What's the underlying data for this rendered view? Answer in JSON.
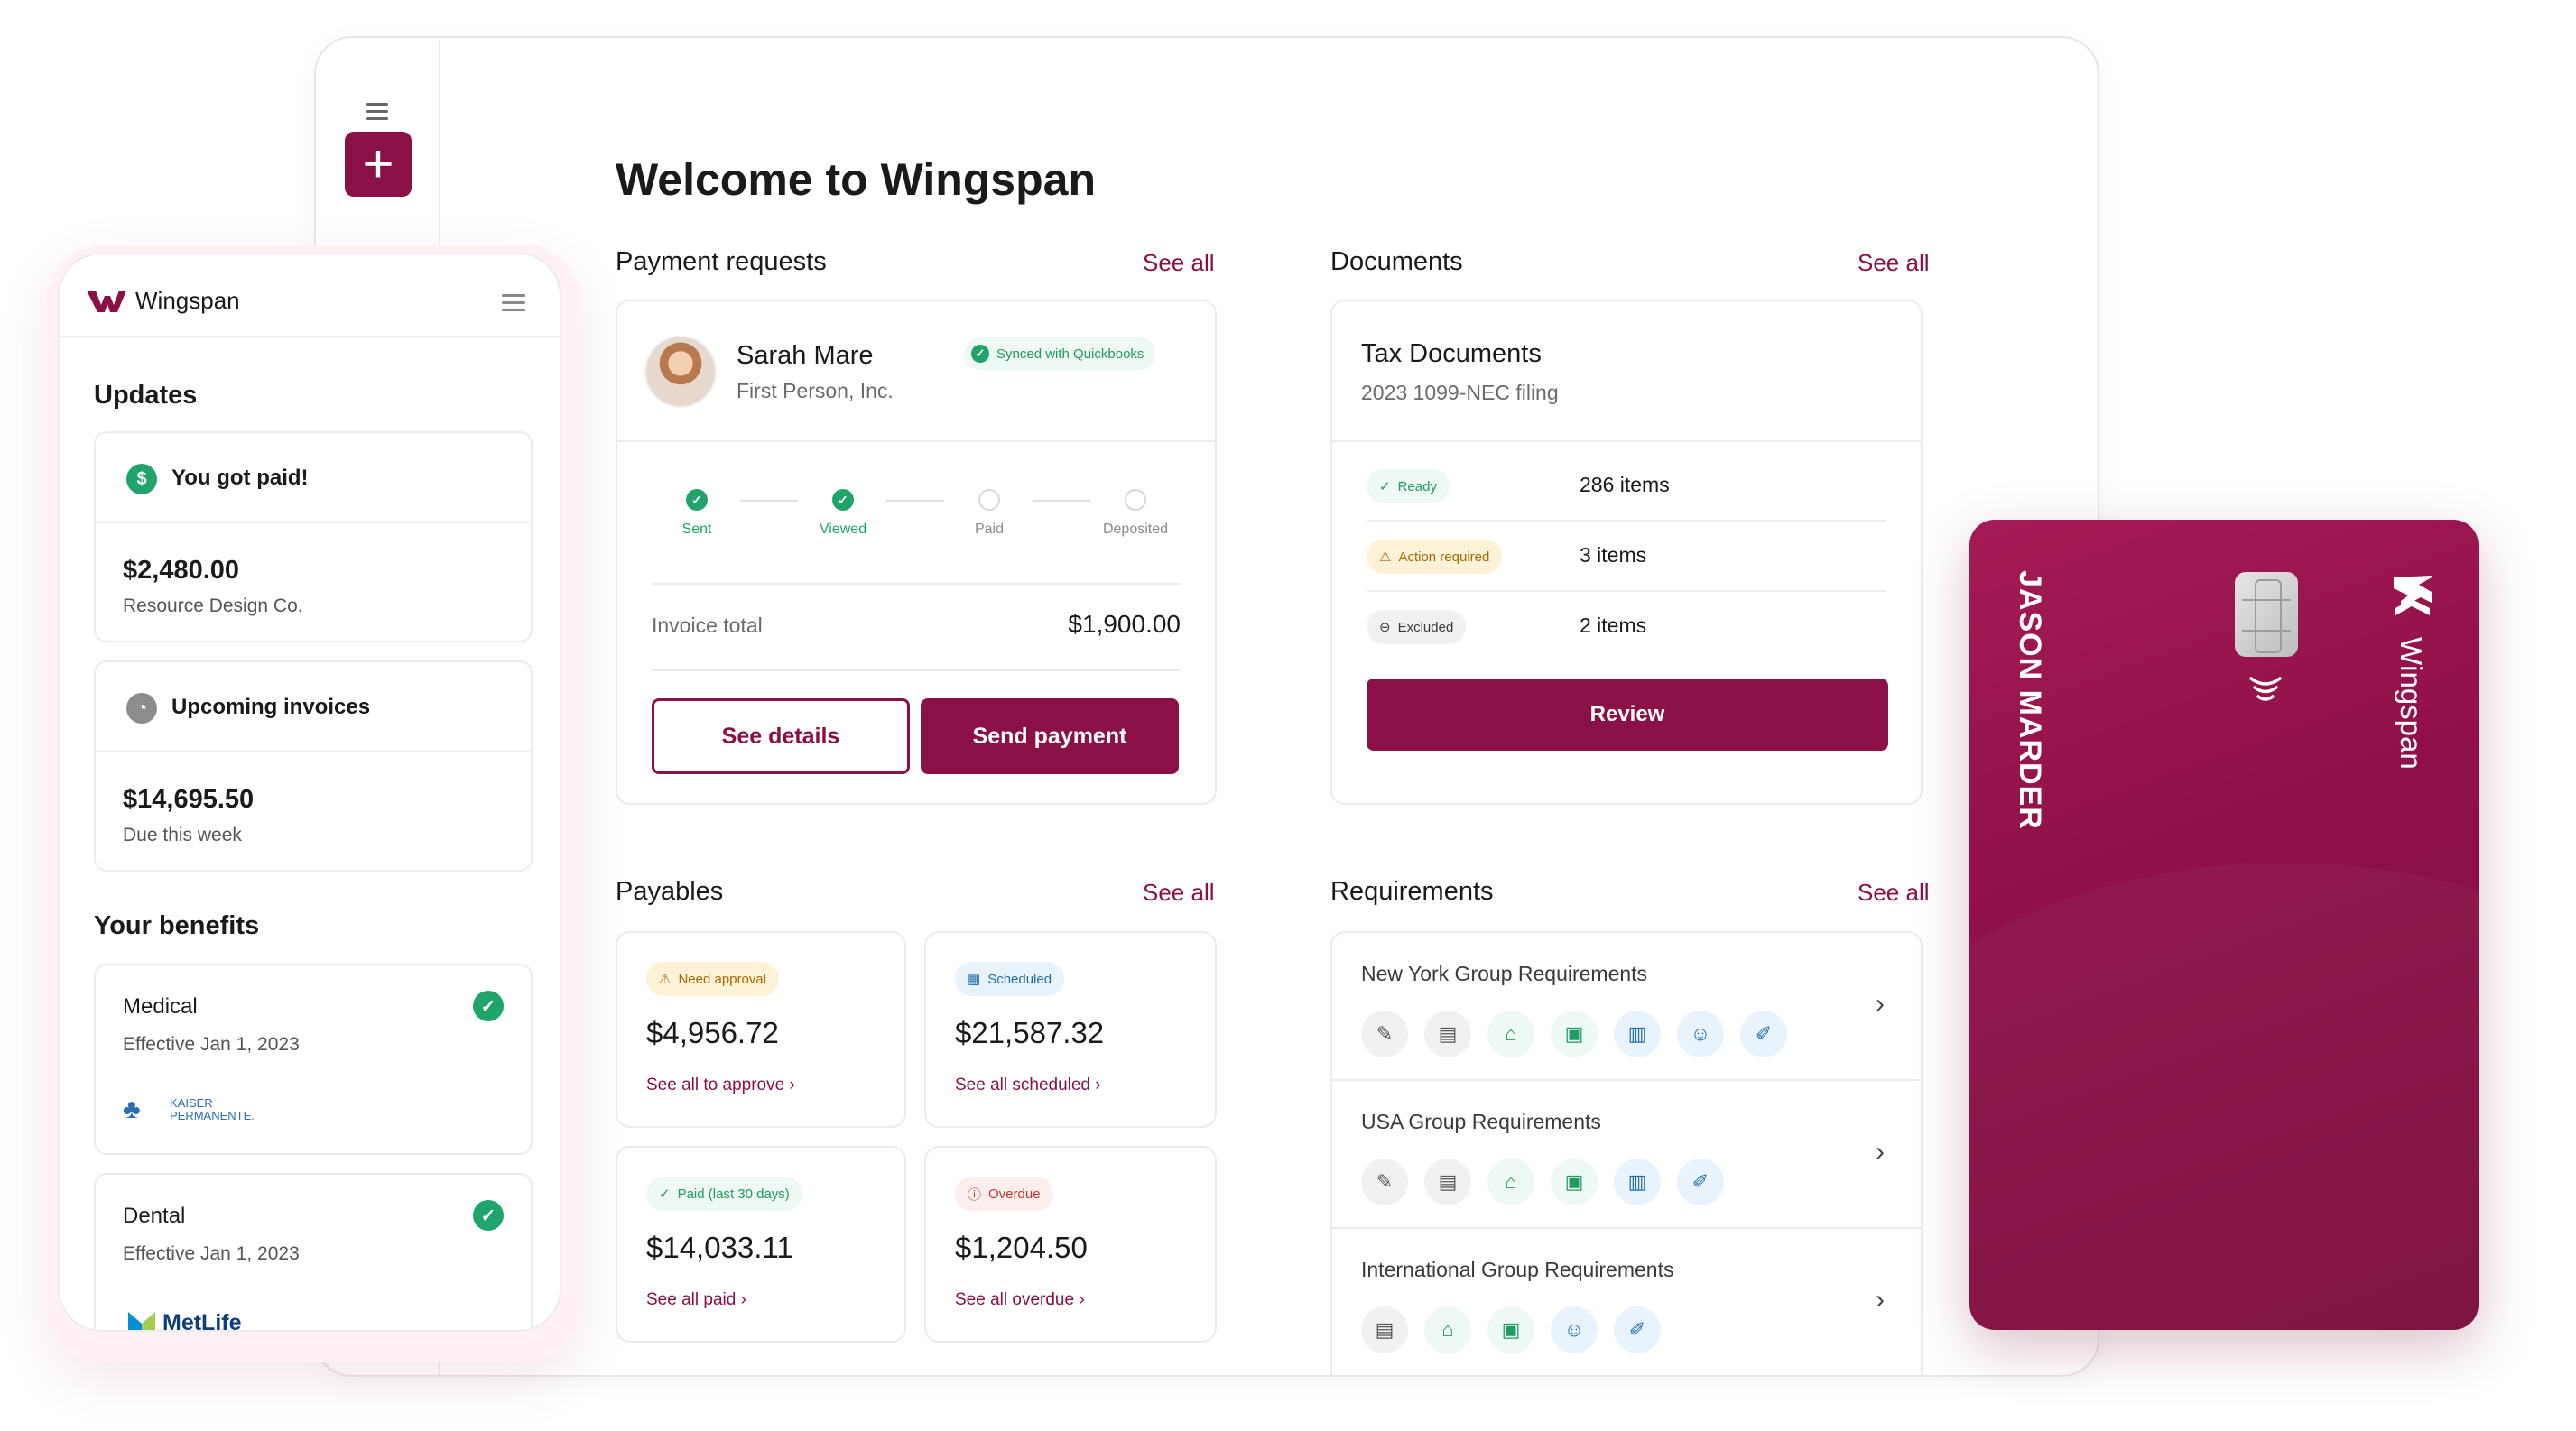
{
  "desktop": {
    "welcome": "Welcome to Wingspan",
    "payment_requests": {
      "title": "Payment requests",
      "see_all": "See all",
      "name": "Sarah Mare",
      "company": "First Person, Inc.",
      "synced": "Synced with Quickbooks",
      "steps": [
        {
          "label": "Sent",
          "done": true
        },
        {
          "label": "Viewed",
          "done": true
        },
        {
          "label": "Paid",
          "done": false
        },
        {
          "label": "Deposited",
          "done": false
        }
      ],
      "invoice_label": "Invoice total",
      "invoice_value": "$1,900.00",
      "see_details": "See details",
      "send_payment": "Send payment"
    },
    "documents": {
      "title": "Documents",
      "see_all": "See all",
      "doc_title": "Tax Documents",
      "doc_sub": "2023 1099-NEC filing",
      "rows": [
        {
          "badge": "Ready",
          "count": "286 items"
        },
        {
          "badge": "Action required",
          "count": "3 items"
        },
        {
          "badge": "Excluded",
          "count": "2 items"
        }
      ],
      "review": "Review"
    },
    "payables": {
      "title": "Payables",
      "see_all": "See all",
      "items": [
        {
          "badge": "Need approval",
          "amount": "$4,956.72",
          "link": "See all to approve"
        },
        {
          "badge": "Scheduled",
          "amount": "$21,587.32",
          "link": "See all scheduled"
        },
        {
          "badge": "Paid (last 30 days)",
          "amount": "$14,033.11",
          "link": "See all paid"
        },
        {
          "badge": "Overdue",
          "amount": "$1,204.50",
          "link": "See all overdue"
        }
      ]
    },
    "requirements": {
      "title": "Requirements",
      "see_all": "See all",
      "rows": [
        {
          "title": "New York Group Requirements"
        },
        {
          "title": "USA Group Requirements"
        },
        {
          "title": "International Group Requirements"
        }
      ]
    }
  },
  "mobile": {
    "brand": "Wingspan",
    "updates_title": "Updates",
    "paid": {
      "title": "You got paid!",
      "amount": "$2,480.00",
      "sub": "Resource Design Co."
    },
    "upcoming": {
      "title": "Upcoming invoices",
      "amount": "$14,695.50",
      "sub": "Due this week"
    },
    "benefits_title": "Your benefits",
    "medical": {
      "title": "Medical",
      "sub": "Effective Jan 1, 2023",
      "provider_line1": "KAISER",
      "provider_line2": "PERMANENTE."
    },
    "dental": {
      "title": "Dental",
      "sub": "Effective Jan 1, 2023",
      "provider": "MetLife"
    }
  },
  "card": {
    "holder": "JASON MARDER",
    "brand": "Wingspan"
  },
  "colors": {
    "brand": "#8a1046",
    "success": "#1fa56c",
    "warning": "#a66a00",
    "info": "#1f6fa8",
    "danger": "#c0392b"
  }
}
